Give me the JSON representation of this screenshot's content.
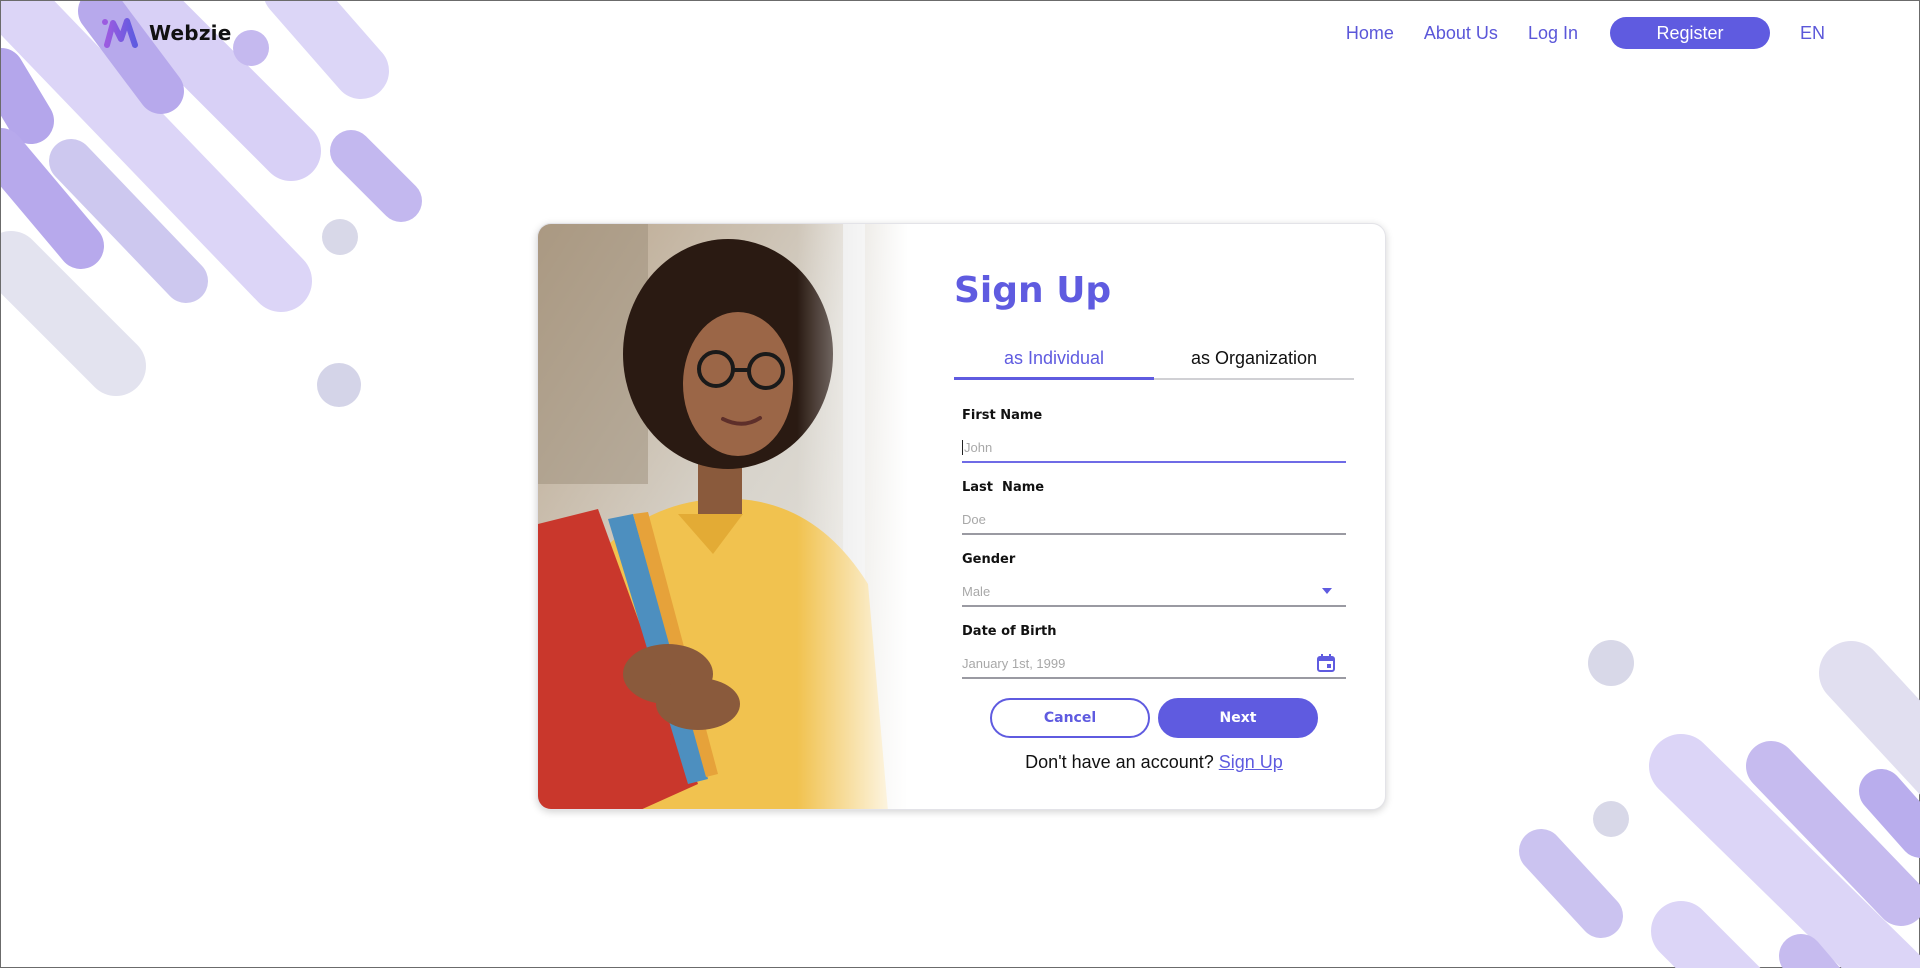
{
  "brand": {
    "name": "Webzie",
    "color": "#5f5be0"
  },
  "nav": {
    "home": "Home",
    "about": "About Us",
    "login": "Log In",
    "register": "Register",
    "language": "EN"
  },
  "signup": {
    "title": "Sign Up",
    "tabs": [
      {
        "label": "as Individual",
        "active": true
      },
      {
        "label": "as Organization",
        "active": false
      }
    ],
    "fields": {
      "first_name": {
        "label": "First Name",
        "placeholder": "John",
        "value": ""
      },
      "last_name": {
        "label": "Last  Name",
        "placeholder": "Doe",
        "value": ""
      },
      "gender": {
        "label": "Gender",
        "selected": "Male",
        "icon": "chevron-down-icon"
      },
      "dob": {
        "label": "Date of Birth",
        "placeholder": "January 1st, 1999",
        "icon": "calendar-icon"
      }
    },
    "buttons": {
      "cancel": "Cancel",
      "next": "Next"
    },
    "footer": {
      "prompt": "Don't have an account?",
      "link": "Sign Up"
    }
  }
}
